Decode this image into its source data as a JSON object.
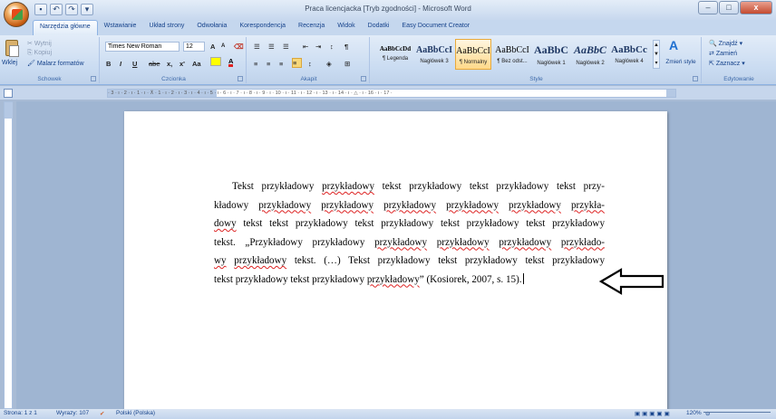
{
  "window": {
    "title": "Praca licencjacka [Tryb zgodności] - Microsoft Word",
    "minimize": "–",
    "maximize": "□",
    "close": "x"
  },
  "quick_access": {
    "save": "▪",
    "undo": "↶",
    "redo": "↷",
    "customize": "▾"
  },
  "tabs": [
    {
      "label": "Narzędzia główne"
    },
    {
      "label": "Wstawianie"
    },
    {
      "label": "Układ strony"
    },
    {
      "label": "Odwołania"
    },
    {
      "label": "Korespondencja"
    },
    {
      "label": "Recenzja"
    },
    {
      "label": "Widok"
    },
    {
      "label": "Dodatki"
    },
    {
      "label": "Easy Document Creator"
    }
  ],
  "ribbon": {
    "clipboard": {
      "label": "Schowek",
      "paste": "Wklej",
      "cut": "Wytnij",
      "copy": "Kopiuj",
      "format_painter": "Malarz formatów"
    },
    "font": {
      "label": "Czcionka",
      "font_name": "Times New Roman",
      "font_size": "12",
      "bold": "B",
      "italic": "I",
      "underline": "U",
      "strike": "abe",
      "subscript": "x,",
      "superscript": "x'",
      "change_case": "Aa",
      "grow": "A",
      "shrink": "A"
    },
    "paragraph": {
      "label": "Akapit",
      "show_marks": "¶"
    },
    "styles": {
      "label": "Style",
      "items": [
        {
          "sample": "AaBbCcDd",
          "name": "¶ Legenda"
        },
        {
          "sample": "AaBbCcI",
          "name": "Nagłówek 3"
        },
        {
          "sample": "AaBbCcI",
          "name": "¶ Normalny"
        },
        {
          "sample": "AaBbCcI",
          "name": "¶ Bez odst..."
        },
        {
          "sample": "AaBbC",
          "name": "Nagłówek 1"
        },
        {
          "sample": "AaBbC",
          "name": "Nagłówek 2"
        },
        {
          "sample": "AaBbCc",
          "name": "Nagłówek 4"
        }
      ],
      "change_styles": "Zmień style"
    },
    "editing": {
      "label": "Edytowanie",
      "find": "Znajdź",
      "replace": "Zamień",
      "select": "Zaznacz"
    }
  },
  "ruler_text": "· 3 · ı · 2 · ı · 1 · ı · ⊼ · 1 · ı · 2 · ı · 3 · ı · 4 · ı · 5 · ı · 6 · ı · 7 · ı · 8 · ı · 9 · ı · 10 · ı · 11 · ı · 12 · ı · 13 · ı · 14 · ı · △ · ı · 16 · ı · 17 ·",
  "document": {
    "lines": [
      [
        {
          "t": "Tekst przykładowy "
        },
        {
          "t": "przykładowy",
          "sq": true
        },
        {
          "t": " tekst przykładowy tekst przykładowy tekst przy-"
        }
      ],
      [
        {
          "t": "kładowy "
        },
        {
          "t": "przykładowy",
          "sq": true
        },
        {
          "t": " "
        },
        {
          "t": "przykładowy",
          "sq": true
        },
        {
          "t": " "
        },
        {
          "t": "przykładowy",
          "sq": true
        },
        {
          "t": " "
        },
        {
          "t": "przykładowy",
          "sq": true
        },
        {
          "t": " "
        },
        {
          "t": "przykładowy",
          "sq": true
        },
        {
          "t": " "
        },
        {
          "t": "przykła-",
          "sq": true
        }
      ],
      [
        {
          "t": "dowy",
          "sq": true
        },
        {
          "t": " tekst tekst przykładowy tekst przykładowy tekst przykładowy tekst przykładowy"
        }
      ],
      [
        {
          "t": "tekst. „Przykładowy przykładowy "
        },
        {
          "t": "przykładowy",
          "sq": true
        },
        {
          "t": " "
        },
        {
          "t": "przykładowy",
          "sq": true
        },
        {
          "t": " "
        },
        {
          "t": "przykładowy",
          "sq": true
        },
        {
          "t": " "
        },
        {
          "t": "przykłado-",
          "sq": true
        }
      ],
      [
        {
          "t": "wy",
          "sq": true
        },
        {
          "t": " "
        },
        {
          "t": "przykładowy",
          "sq": true
        },
        {
          "t": " tekst. (…) Tekst przykładowy tekst przykładowy tekst przykładowy"
        }
      ],
      [
        {
          "t": "tekst przykładowy tekst przykładowy "
        },
        {
          "t": "przykładowy",
          "sq": true
        },
        {
          "t": "” (Kosiorek, 2007, s. 15)."
        }
      ]
    ]
  },
  "status": {
    "page": "Strona: 1 z 1",
    "words": "Wyrazy: 107",
    "language": "Polski (Polska)",
    "zoom": "120%"
  }
}
